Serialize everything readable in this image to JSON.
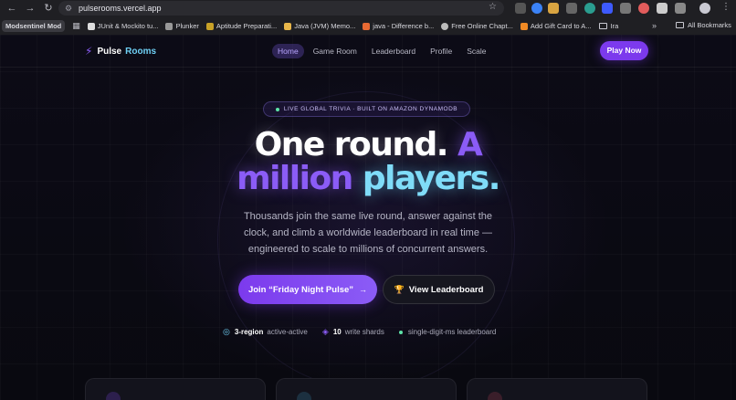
{
  "browser": {
    "url": "pulserooms.vercel.app",
    "bookmarks": [
      {
        "label": "Modsentinel Mod"
      },
      {
        "label": "JUnit & Mockito tu..."
      },
      {
        "label": "Plunker"
      },
      {
        "label": "Aptitude Preparati..."
      },
      {
        "label": "Java (JVM) Memo..."
      },
      {
        "label": "java - Difference b..."
      },
      {
        "label": "Free Online Chapt..."
      },
      {
        "label": "Add Gift Card to A..."
      },
      {
        "label": "Ira"
      }
    ],
    "more": "»",
    "all_bookmarks": "All Bookmarks"
  },
  "site": {
    "brand_part1": "Pulse",
    "brand_part2": "Rooms",
    "nav": [
      {
        "label": "Home",
        "active": true
      },
      {
        "label": "Game Room",
        "active": false
      },
      {
        "label": "Leaderboard",
        "active": false
      },
      {
        "label": "Profile",
        "active": false
      },
      {
        "label": "Scale",
        "active": false
      }
    ],
    "play_now": "Play Now"
  },
  "hero": {
    "pill": "LIVE GLOBAL TRIVIA · BUILT ON AMAZON DYNAMODB",
    "headline_line1_white": "One round.",
    "headline_line1_purple": "A",
    "headline_line2_purple": "million",
    "headline_line2_cyan": "players.",
    "subtext": "Thousands join the same live round, answer against the clock, and climb a worldwide leaderboard in real time — engineered to scale to millions of concurrent answers.",
    "primary_cta": "Join “Friday Night Pulse”",
    "primary_cta_arrow": "→",
    "secondary_cta": "View Leaderboard"
  },
  "stats": [
    {
      "strong": "3-region",
      "text": "active-active"
    },
    {
      "strong": "10",
      "text": "write shards"
    },
    {
      "strong": "",
      "text": "single-digit-ms leaderboard"
    }
  ],
  "colors": {
    "accent": "#7c3aed",
    "purple_text": "#8b5cf6",
    "cyan_text": "#7fdcf8",
    "live_dot": "#5ee3a8",
    "background": "#0a0a12"
  }
}
